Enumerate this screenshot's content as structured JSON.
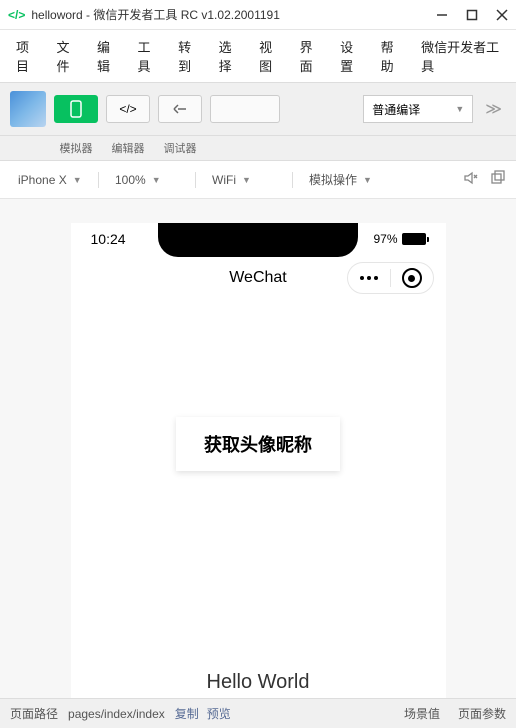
{
  "titlebar": {
    "title": "helloword - 微信开发者工具 RC v1.02.2001191"
  },
  "menubar": [
    "项目",
    "文件",
    "编辑",
    "工具",
    "转到",
    "选择",
    "视图",
    "界面",
    "设置",
    "帮助",
    "微信开发者工具"
  ],
  "toolbar": {
    "compile_label": "普通编译",
    "labels": [
      "模拟器",
      "编辑器",
      "调试器"
    ]
  },
  "page_toolbar": {
    "device": "iPhone X",
    "zoom": "100%",
    "network": "WiFi",
    "mock": "模拟操作"
  },
  "simulator": {
    "time": "10:24",
    "battery_pct": "97%",
    "header_title": "WeChat",
    "get_info_btn": "获取头像昵称",
    "hello_text": "Hello World"
  },
  "bottom": {
    "path_label": "页面路径",
    "path_value": "pages/index/index",
    "copy": "复制",
    "preview": "预览",
    "scene": "场景值",
    "params": "页面参数"
  }
}
